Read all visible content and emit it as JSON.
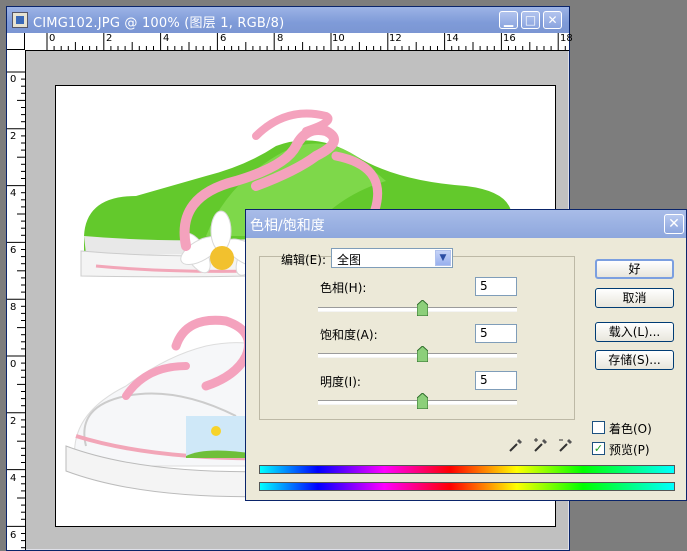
{
  "document_window": {
    "title": "CIMG102.JPG @ 100% (图层 1, RGB/8)",
    "ruler_top_numbers": [
      "0",
      "2",
      "4",
      "6",
      "8",
      "10",
      "12",
      "14",
      "16",
      "18"
    ],
    "ruler_left_numbers": [
      "0",
      "2",
      "4",
      "6",
      "8",
      "0",
      "2",
      "4",
      "6"
    ]
  },
  "dialog": {
    "title": "色相/饱和度",
    "edit_label": "编辑(E):",
    "edit_value": "全图",
    "hue_label": "色相(H):",
    "hue_value": "5",
    "saturation_label": "饱和度(A):",
    "saturation_value": "5",
    "lightness_label": "明度(I):",
    "lightness_value": "5",
    "ok_label": "好",
    "cancel_label": "取消",
    "load_label": "载入(L)...",
    "save_label": "存储(S)...",
    "colorize_label": "着色(O)",
    "colorize_checked": false,
    "preview_label": "预览(P)",
    "preview_checked": true
  },
  "icons": {
    "app": "photoshop-doc-icon",
    "minimize": "minimize-icon",
    "maximize": "maximize-icon",
    "close": "close-icon",
    "dropdown": "chevron-down-icon",
    "eyedropper": "eyedropper-icon"
  }
}
